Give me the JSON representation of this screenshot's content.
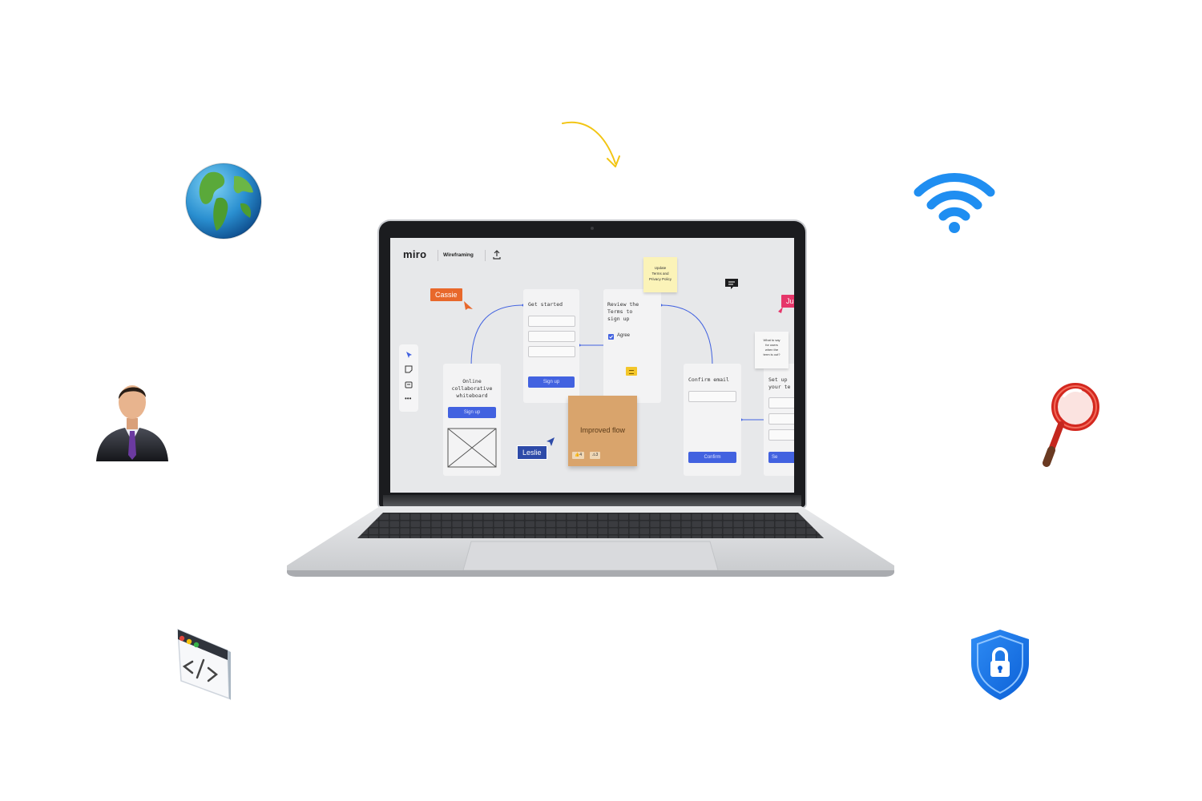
{
  "icons": {
    "globe": "globe-icon",
    "user": "businessman-icon",
    "code": "code-window-icon",
    "wifi": "wifi-icon",
    "search": "magnifier-icon",
    "shield": "shield-lock-icon",
    "arrow": "curved-arrow-icon"
  },
  "colors": {
    "miro_blue": "#4262e0",
    "cassie_tag": "#e8682b",
    "leslie_tag": "#2d4aa8",
    "ju_tag": "#e6366a",
    "sticky_tan": "#d9a46c",
    "sticky_yellow": "#fbf3b8",
    "wifi_blue": "#1f8ef1",
    "arrow_yellow": "#f2c514"
  },
  "miro": {
    "logo": "miro",
    "board_name": "Wireframing",
    "cursors": {
      "cassie": "Cassie",
      "leslie": "Leslie",
      "ju": "Ju"
    },
    "frames": {
      "landing": {
        "title": "Online\ncollaborative\nwhiteboard",
        "button": "Sign up"
      },
      "get_started": {
        "title": "Get started",
        "button": "Sign up"
      },
      "review": {
        "title": "Review the\nTerms to\nsign up",
        "checkbox": "Agree"
      },
      "confirm": {
        "title": "Confirm email",
        "button": "Confirm"
      },
      "setup": {
        "title": "Set up\nyour te",
        "button": "Se"
      }
    },
    "stickies": {
      "terms": "Update\nTerms and\nPrivacy Policy",
      "improved": "Improved flow",
      "question": "What to say\nfor users\nwhen the\nterm is out?"
    },
    "sticky_votes": [
      "4",
      "3"
    ]
  }
}
